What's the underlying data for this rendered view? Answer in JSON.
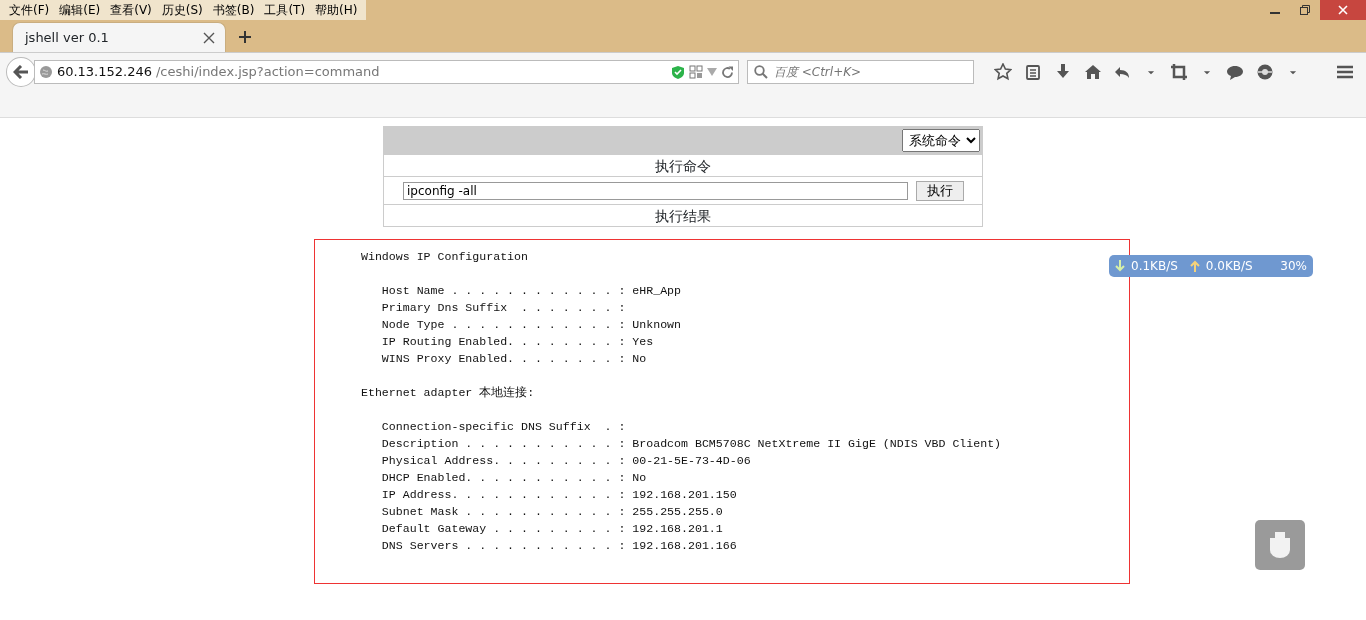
{
  "menu_bar": [
    "文件(F)",
    "编辑(E)",
    "查看(V)",
    "历史(S)",
    "书签(B)",
    "工具(T)",
    "帮助(H)"
  ],
  "tabs": [
    {
      "title": "jshell ver 0.1",
      "selected": true
    }
  ],
  "address_bar": {
    "host": "60.13.152.246",
    "path": "/ceshi/index.jsp?action=command"
  },
  "search": {
    "placeholder": "百度 <Ctrl+K>"
  },
  "form": {
    "mode_select": "系统命令",
    "command_heading": "执行命令",
    "command": "ipconfig -all",
    "run_button": "执行",
    "result_heading": "执行结果"
  },
  "output_blocks": [
    [
      "Windows IP Configuration"
    ],
    [
      "   Host Name . . . . . . . . . . . . : eHR_App",
      "   Primary Dns Suffix  . . . . . . . :",
      "   Node Type . . . . . . . . . . . . : Unknown",
      "   IP Routing Enabled. . . . . . . . : Yes",
      "   WINS Proxy Enabled. . . . . . . . : No"
    ],
    [
      "Ethernet adapter 本地连接:"
    ],
    [
      "   Connection-specific DNS Suffix  . :",
      "   Description . . . . . . . . . . . : Broadcom BCM5708C NetXtreme II GigE (NDIS VBD Client)",
      "   Physical Address. . . . . . . . . : 00-21-5E-73-4D-06",
      "   DHCP Enabled. . . . . . . . . . . : No",
      "   IP Address. . . . . . . . . . . . : 192.168.201.150",
      "   Subnet Mask . . . . . . . . . . . : 255.255.255.0",
      "   Default Gateway . . . . . . . . . : 192.168.201.1",
      "   DNS Servers . . . . . . . . . . . : 192.168.201.166"
    ]
  ],
  "speed_widget": {
    "download": "0.1KB/S",
    "upload": "0.0KB/S",
    "percent": "30%"
  }
}
